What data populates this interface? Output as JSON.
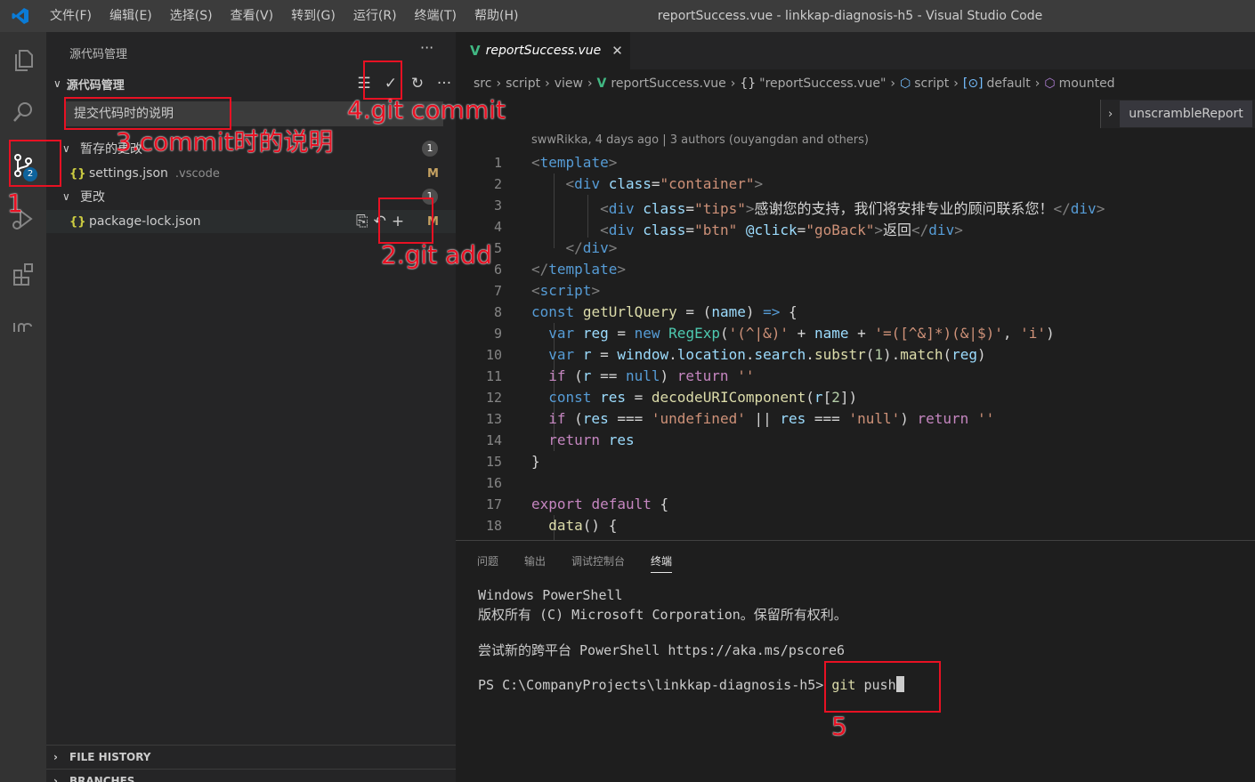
{
  "titlebar": {
    "menu": [
      "文件(F)",
      "编辑(E)",
      "选择(S)",
      "查看(V)",
      "转到(G)",
      "运行(R)",
      "终端(T)",
      "帮助(H)"
    ],
    "title": "reportSuccess.vue - linkkap-diagnosis-h5 - Visual Studio Code"
  },
  "activitybar": {
    "icons": [
      "files-icon",
      "search-icon",
      "source-control-icon",
      "run-debug-icon",
      "extensions-icon",
      "gitlens-icon"
    ],
    "scm_badge": "2"
  },
  "sidebar": {
    "title": "源代码管理",
    "more": "···",
    "section_label": "源代码管理",
    "commit_placeholder": "提交代码时的说明",
    "staged_label": "暂存的更改",
    "staged_count": "1",
    "staged_file": {
      "name": "settings.json",
      "dir": ".vscode",
      "status": "M"
    },
    "changes_label": "更改",
    "changes_count": "1",
    "changes_file": {
      "name": "package-lock.json",
      "status": "M"
    },
    "file_history": "FILE HISTORY",
    "branches": "BRANCHES"
  },
  "editor": {
    "tab_name": "reportSuccess.vue",
    "breadcrumb": {
      "src": "src",
      "script": "script",
      "view": "view",
      "file": "reportSuccess.vue",
      "obj": "\"reportSuccess.vue\"",
      "scr": "script",
      "def": "default",
      "mounted": "mounted"
    },
    "outline_item": "unscrambleReport",
    "blame": "swwRikka, 4 days ago | 3 authors (ouyangdan and others)",
    "line_numbers": [
      "1",
      "2",
      "3",
      "4",
      "5",
      "6",
      "7",
      "8",
      "9",
      "10",
      "11",
      "12",
      "13",
      "14",
      "15",
      "16",
      "17",
      "18"
    ],
    "code": {
      "l3_text": "感谢您的支持，我们将安排专业的顾问联系您！",
      "l4_text": "返回"
    }
  },
  "panel": {
    "tabs": [
      "问题",
      "输出",
      "调试控制台",
      "终端"
    ],
    "active_tab": "终端",
    "terminal_lines": [
      "Windows PowerShell",
      "版权所有 (C) Microsoft Corporation。保留所有权利。",
      "尝试新的跨平台 PowerShell https://aka.ms/pscore6"
    ],
    "prompt": "PS C:\\CompanyProjects\\linkkap-diagnosis-h5> ",
    "cmd_git": "git",
    "cmd_rest": " push"
  },
  "annotations": {
    "a1": "1",
    "a2": "2.git add",
    "a3": "3.commit时的说明",
    "a4": "4.git commit",
    "a5": "5",
    "color": "#e81123"
  }
}
